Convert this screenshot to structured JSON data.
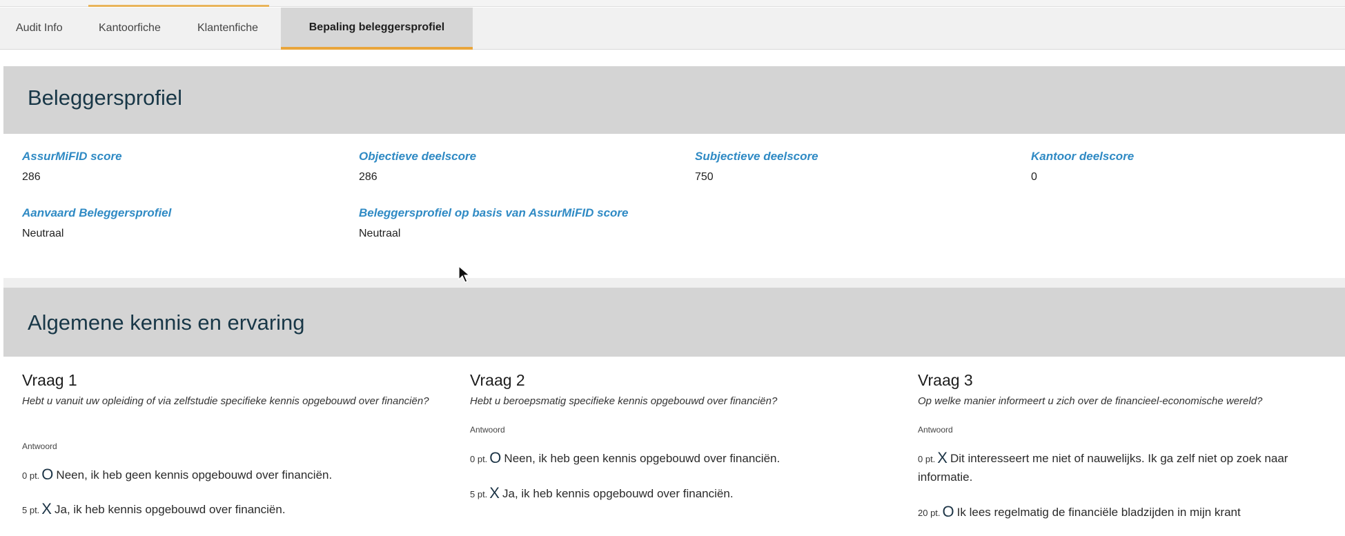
{
  "tabs": [
    "Audit Info",
    "Kantoorfiche",
    "Klantenfiche",
    "Bepaling beleggersprofiel"
  ],
  "active_tab": "Bepaling beleggersprofiel",
  "profile": {
    "title": "Beleggersprofiel",
    "fields": [
      {
        "label": "AssurMiFID score",
        "value": "286"
      },
      {
        "label": "Objectieve deelscore",
        "value": "286"
      },
      {
        "label": "Subjectieve deelscore",
        "value": "750"
      },
      {
        "label": "Kantoor deelscore",
        "value": "0"
      },
      {
        "label": "Aanvaard Beleggersprofiel",
        "value": "Neutraal"
      },
      {
        "label": "Beleggersprofiel op basis van AssurMiFID score",
        "value": "Neutraal"
      }
    ]
  },
  "knowledge": {
    "title": "Algemene kennis en ervaring",
    "questions": [
      {
        "title": "Vraag 1",
        "text": "Hebt u vanuit uw opleiding of via zelfstudie specifieke kennis opgebouwd over financiën?",
        "answer_label": "Antwoord",
        "options": [
          {
            "points": "0 pt.",
            "mark": "O",
            "text": "Neen, ik heb geen kennis opgebouwd over financiën."
          },
          {
            "points": "5 pt.",
            "mark": "X",
            "text": "Ja, ik heb kennis opgebouwd over financiën."
          }
        ]
      },
      {
        "title": "Vraag 2",
        "text": "Hebt u beroepsmatig specifieke kennis opgebouwd over financiën?",
        "answer_label": "Antwoord",
        "options": [
          {
            "points": "0 pt.",
            "mark": "O",
            "text": "Neen, ik heb geen kennis opgebouwd over financiën."
          },
          {
            "points": "5 pt.",
            "mark": "X",
            "text": "Ja, ik heb kennis opgebouwd over financiën."
          }
        ]
      },
      {
        "title": "Vraag 3",
        "text": "Op welke manier informeert u zich over de financieel-economische wereld?",
        "answer_label": "Antwoord",
        "options": [
          {
            "points": "0 pt.",
            "mark": "X",
            "text": "Dit interesseert me niet of nauwelijks. Ik ga zelf niet op zoek naar informatie."
          },
          {
            "points": "20 pt.",
            "mark": "O",
            "text": "Ik lees regelmatig de financiële bladzijden in mijn krant"
          }
        ]
      }
    ]
  },
  "colors": {
    "accent": "#e9a53b",
    "label_blue": "#2f8ac4",
    "title_dark": "#183747"
  }
}
